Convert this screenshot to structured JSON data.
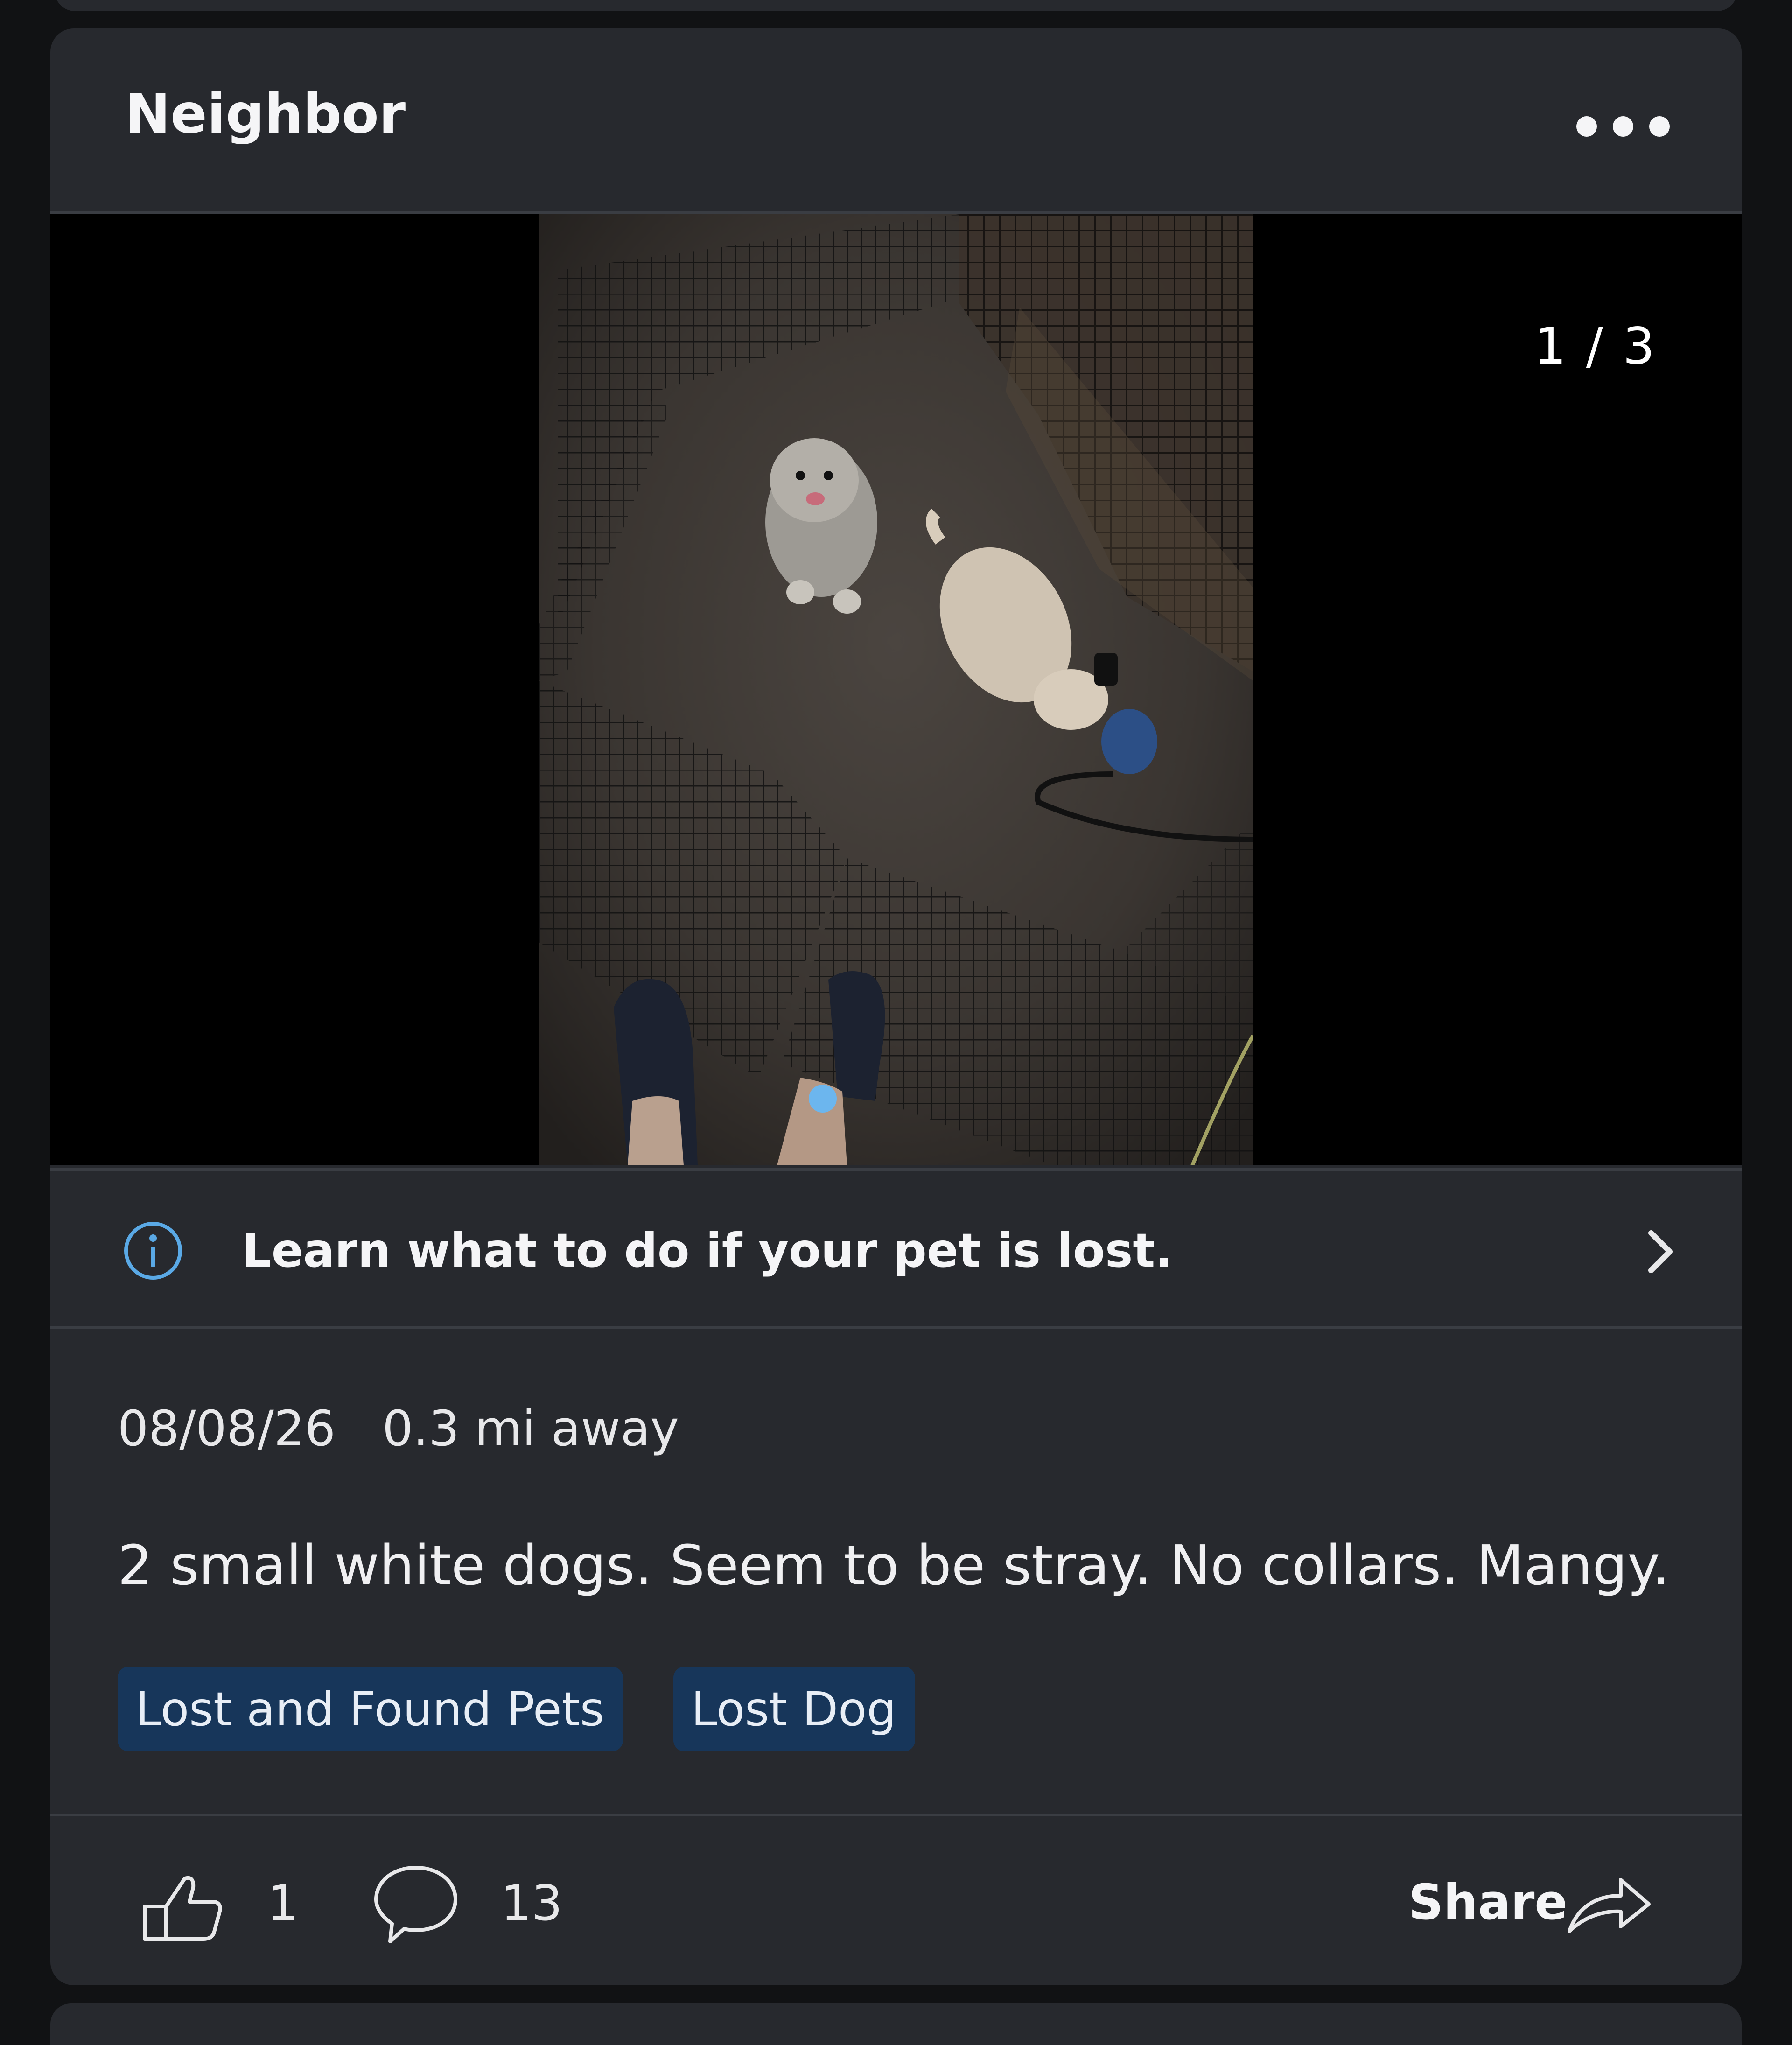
{
  "post": {
    "author": "Neighbor",
    "more_icon": "more-horizontal-icon",
    "media": {
      "counter": "1 / 3",
      "image_description": "Night photo: two small white dogs inside a black wire pen, blue retractable leash, person's feet in sandals"
    },
    "info_banner": {
      "icon": "info-icon",
      "text": "Learn what to do if your pet is lost.",
      "chevron": "chevron-right-icon"
    },
    "date": "08/08/26",
    "distance": "0.3 mi away",
    "body": "2 small white dogs. Seem to be stray. No collars. Mangy.",
    "tags": [
      "Lost and Found Pets",
      "Lost Dog"
    ],
    "actions": {
      "like_icon": "thumbs-up-icon",
      "like_count": "1",
      "comment_icon": "comment-bubble-icon",
      "comment_count": "13",
      "share_label": "Share",
      "share_icon": "share-arrow-icon"
    }
  },
  "colors": {
    "card_background": "#27292e",
    "page_background": "#111214",
    "tag_background": "#17365a",
    "accent_blue": "#5aa9e6",
    "text_primary": "#f5f5f7"
  }
}
